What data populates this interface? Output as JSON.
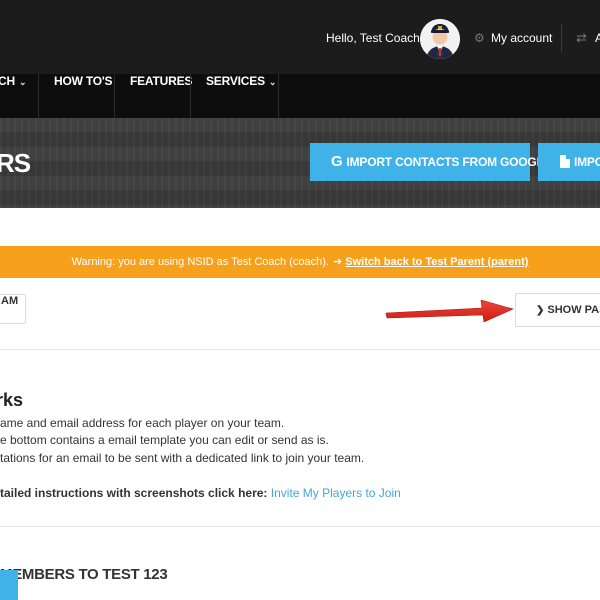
{
  "header": {
    "logo_fragment": "’",
    "greeting": "Hello, Test Coach",
    "my_account_label": "My account",
    "cut_label": "A"
  },
  "nav": {
    "items": [
      {
        "label": "CH"
      },
      {
        "label": "HOW TO'S"
      },
      {
        "label": "FEATURES"
      },
      {
        "label": "SERVICES"
      }
    ]
  },
  "banner": {
    "title_fragment": "RS",
    "import_google_label": "IMPORT CONTACTS FROM GOOGLE",
    "import_google_icon_glyph": "G",
    "import_other_label": "IMPO"
  },
  "warning": {
    "text": "Warning: you are using NSID as Test Coach (coach).",
    "switch_link": "Switch back to Test Parent (parent)"
  },
  "toolbar": {
    "team_button_label": "AM",
    "show_past_label": "SHOW PAST"
  },
  "how_it_works": {
    "heading": "rks",
    "lines": [
      "ame and email address for each player on your team.",
      "e bottom contains a email template you can edit or send as is.",
      "tations for an email to be sent with a dedicated link to join your team."
    ],
    "instructions_prefix": "tailed instructions with screenshots click here:",
    "instructions_link": "Invite My Players to Join"
  },
  "members_section": {
    "heading": "MEMBERS TO TEST 123"
  },
  "colors": {
    "accent_blue": "#3fb3e8",
    "warning_orange": "#f7a01c",
    "annotation_arrow": "#e0241b",
    "link": "#3fa9d8"
  }
}
